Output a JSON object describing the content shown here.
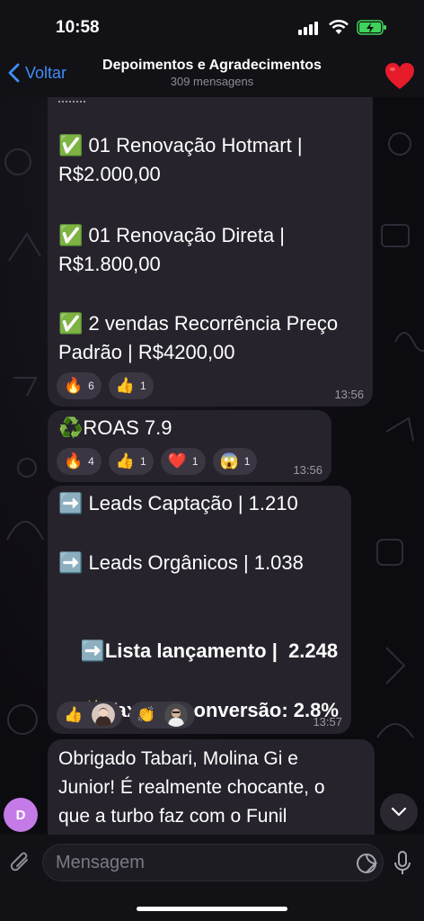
{
  "status_bar": {
    "time": "10:58"
  },
  "header": {
    "back_label": "Voltar",
    "title": "Depoimentos e Agradecimentos",
    "subtitle": "309 mensagens",
    "avatar_emoji": "❤️"
  },
  "messages": [
    {
      "lines": [
        "✅ 01 Renovação Hotmart |\nR$2.000,00",
        "✅ 01 Renovação Direta |\nR$1.800,00",
        "✅ 2 vendas Recorrência Preço\nPadrão | R$4200,00"
      ],
      "reactions": [
        {
          "emoji": "🔥",
          "count": "6"
        },
        {
          "emoji": "👍",
          "count": "1"
        }
      ],
      "time": "13:56"
    },
    {
      "text": "♻️ROAS 7.9",
      "reactions": [
        {
          "emoji": "🔥",
          "count": "4"
        },
        {
          "emoji": "👍",
          "count": "1"
        },
        {
          "emoji": "❤️",
          "count": "1"
        },
        {
          "emoji": "😱",
          "count": "1"
        }
      ],
      "time": "13:56"
    },
    {
      "line1": "➡️ Leads Captação | 1.210",
      "line2": "➡️ Leads Orgânicos | 1.038",
      "line3_prefix": "➡️",
      "line3_bold": "Lista lançamento |  2.248",
      "line4_prefix": "✨",
      "line4_bold": "Taxa de conversão: 2.8%",
      "reactions": [
        {
          "emoji": "👍"
        },
        {
          "emoji": "👏"
        }
      ],
      "time": "13:57"
    },
    {
      "text": "Obrigado Tabari, Molina Gi e\nJunior! É realmente chocante, o\nque a turbo faz com o Funil"
    }
  ],
  "sender_avatar_letter": "D",
  "input": {
    "placeholder": "Mensagem"
  },
  "colors": {
    "accent": "#3e8ef7",
    "bubble": "#26232c",
    "avatar": "#c47be8"
  }
}
